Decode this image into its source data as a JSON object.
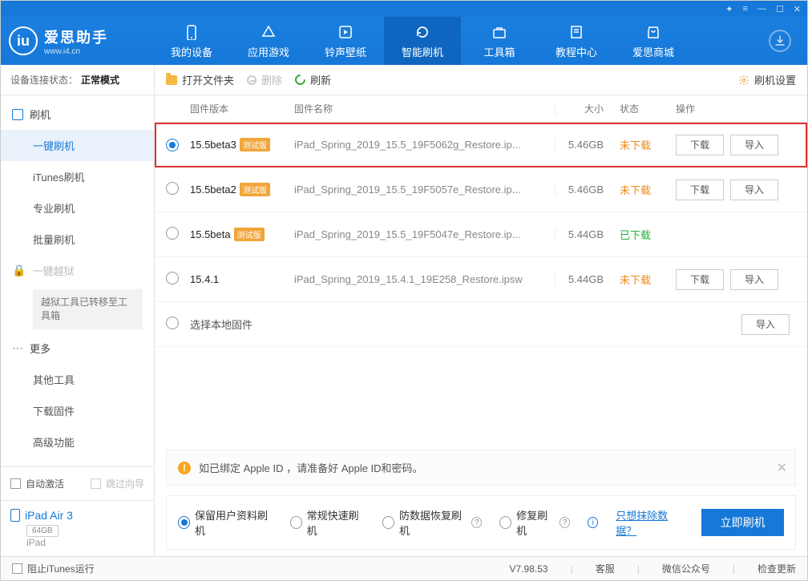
{
  "titlebar": {
    "icons": [
      "✦",
      "☰",
      "—",
      "◻",
      "✕"
    ]
  },
  "header": {
    "brand": "爱思助手",
    "brand_sub": "www.i4.cn",
    "nav": [
      {
        "label": "我的设备",
        "icon": "phone"
      },
      {
        "label": "应用游戏",
        "icon": "apps"
      },
      {
        "label": "铃声壁纸",
        "icon": "music"
      },
      {
        "label": "智能刷机",
        "icon": "refresh",
        "active": true
      },
      {
        "label": "工具箱",
        "icon": "toolbox"
      },
      {
        "label": "教程中心",
        "icon": "book"
      },
      {
        "label": "爱思商城",
        "icon": "shop"
      }
    ]
  },
  "sidebar": {
    "status_label": "设备连接状态：",
    "status_value": "正常模式",
    "group_flash_label": "刷机",
    "items_flash": [
      {
        "label": "一键刷机",
        "active": true
      },
      {
        "label": "iTunes刷机"
      },
      {
        "label": "专业刷机"
      },
      {
        "label": "批量刷机"
      }
    ],
    "jailbreak_label": "一键越狱",
    "jailbreak_note": "越狱工具已转移至工具箱",
    "group_more_label": "更多",
    "items_more": [
      {
        "label": "其他工具"
      },
      {
        "label": "下载固件"
      },
      {
        "label": "高级功能"
      }
    ],
    "auto_activate": "自动激活",
    "skip_guide": "跳过向导",
    "device_name": "iPad Air 3",
    "device_storage": "64GB",
    "device_type": "iPad"
  },
  "toolbar": {
    "open_folder": "打开文件夹",
    "delete": "删除",
    "refresh": "刷新",
    "settings": "刷机设置"
  },
  "table": {
    "headers": {
      "version": "固件版本",
      "name": "固件名称",
      "size": "大小",
      "status": "状态",
      "action": "操作"
    },
    "beta_tag": "测试版",
    "btn_download": "下载",
    "btn_import": "导入",
    "rows": [
      {
        "selected": true,
        "highlighted": true,
        "version": "15.5beta3",
        "beta": true,
        "name": "iPad_Spring_2019_15.5_19F5062g_Restore.ip...",
        "size": "5.46GB",
        "status": "未下载",
        "status_cls": "st-pending",
        "show_download": true,
        "show_import": true
      },
      {
        "selected": false,
        "version": "15.5beta2",
        "beta": true,
        "name": "iPad_Spring_2019_15.5_19F5057e_Restore.ip...",
        "size": "5.46GB",
        "status": "未下载",
        "status_cls": "st-pending",
        "show_download": true,
        "show_import": true
      },
      {
        "selected": false,
        "version": "15.5beta",
        "beta": true,
        "name": "iPad_Spring_2019_15.5_19F5047e_Restore.ip...",
        "size": "5.44GB",
        "status": "已下载",
        "status_cls": "st-done",
        "show_download": false,
        "show_import": false
      },
      {
        "selected": false,
        "version": "15.4.1",
        "beta": false,
        "name": "iPad_Spring_2019_15.4.1_19E258_Restore.ipsw",
        "size": "5.44GB",
        "status": "未下载",
        "status_cls": "st-pending",
        "show_download": true,
        "show_import": true
      }
    ],
    "local_row_label": "选择本地固件"
  },
  "alert": {
    "text": "如已绑定 Apple ID ，请准备好 Apple ID和密码。"
  },
  "options": {
    "opt1": "保留用户资料刷机",
    "opt2": "常规快速刷机",
    "opt3": "防数据恢复刷机",
    "opt4": "修复刷机",
    "erase_link": "只想抹除数据？",
    "go_btn": "立即刷机"
  },
  "footer": {
    "stop_itunes": "阻止iTunes运行",
    "version": "V7.98.53",
    "service": "客服",
    "wechat": "微信公众号",
    "check_update": "检查更新"
  }
}
